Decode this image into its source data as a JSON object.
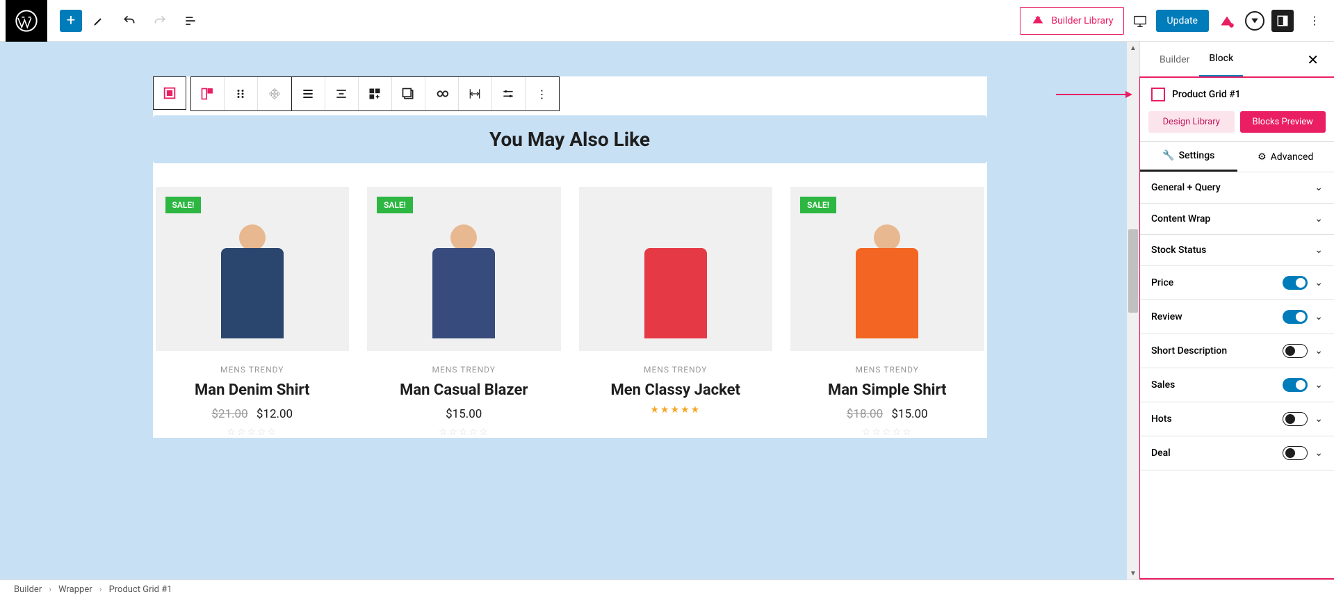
{
  "topbar": {
    "builder_library": "Builder Library",
    "update": "Update"
  },
  "canvas": {
    "section_title": "You May Also Like"
  },
  "products": [
    {
      "sale": "SALE!",
      "category": "MENS  TRENDY",
      "title": "Man Denim Shirt",
      "old_price": "$21.00",
      "price": "$12.00",
      "rating": 0,
      "body_color": "#2a466e",
      "head_color": "#e8b890"
    },
    {
      "sale": "SALE!",
      "category": "MENS  TRENDY",
      "title": "Man Casual Blazer",
      "old_price": "",
      "price": "$15.00",
      "rating": 0,
      "body_color": "#374b7c",
      "head_color": "#e8b890"
    },
    {
      "sale": "",
      "category": "MENS  TRENDY",
      "title": "Men Classy Jacket",
      "old_price": "",
      "price": "",
      "rating": 5,
      "body_color": "#e63946",
      "head_color": "transparent"
    },
    {
      "sale": "SALE!",
      "category": "MENS  TRENDY",
      "title": "Man Simple Shirt",
      "old_price": "$18.00",
      "price": "$15.00",
      "rating": 0,
      "body_color": "#f26522",
      "head_color": "#e8b890"
    }
  ],
  "sidebar": {
    "tab_builder": "Builder",
    "tab_block": "Block",
    "block_name": "Product Grid #1",
    "design_library": "Design Library",
    "blocks_preview": "Blocks Preview",
    "tab_settings": "Settings",
    "tab_advanced": "Advanced",
    "panels": [
      {
        "title": "General + Query",
        "toggle": null
      },
      {
        "title": "Content Wrap",
        "toggle": null
      },
      {
        "title": "Stock Status",
        "toggle": null
      },
      {
        "title": "Price",
        "toggle": true
      },
      {
        "title": "Review",
        "toggle": true
      },
      {
        "title": "Short Description",
        "toggle": false
      },
      {
        "title": "Sales",
        "toggle": true
      },
      {
        "title": "Hots",
        "toggle": false
      },
      {
        "title": "Deal",
        "toggle": false
      }
    ]
  },
  "breadcrumb": [
    "Builder",
    "Wrapper",
    "Product Grid #1"
  ]
}
